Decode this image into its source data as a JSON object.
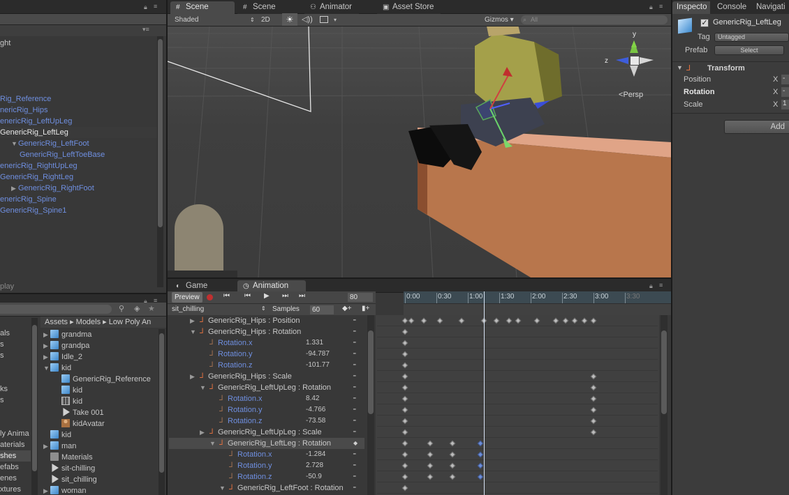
{
  "colors": {
    "accent_blue": "#6f8fe0",
    "record_red": "#c03030",
    "playhead": "#d8e4f5",
    "crate": "#c98a60"
  },
  "hierarchy": {
    "items": [
      {
        "label": "ght",
        "indent": 0,
        "arrow": "",
        "selected": false,
        "color": "grey"
      },
      {
        "label": "Rig_Reference",
        "indent": 0,
        "arrow": "",
        "selected": false,
        "color": "blue"
      },
      {
        "label": "nericRig_Hips",
        "indent": 0,
        "arrow": "",
        "selected": false,
        "color": "blue"
      },
      {
        "label": "enericRig_LeftUpLeg",
        "indent": 0,
        "arrow": "",
        "selected": false,
        "color": "blue"
      },
      {
        "label": "GenericRig_LeftLeg",
        "indent": 0,
        "arrow": "",
        "selected": true,
        "color": "white"
      },
      {
        "label": "GenericRig_LeftFoot",
        "indent": 1,
        "arrow": "▼",
        "selected": false,
        "color": "blue"
      },
      {
        "label": "GenericRig_LeftToeBase",
        "indent": 2,
        "arrow": "",
        "selected": false,
        "color": "blue"
      },
      {
        "label": "enericRig_RightUpLeg",
        "indent": 0,
        "arrow": "",
        "selected": false,
        "color": "blue"
      },
      {
        "label": "GenericRig_RightLeg",
        "indent": 0,
        "arrow": "",
        "selected": false,
        "color": "blue"
      },
      {
        "label": "GenericRig_RightFoot",
        "indent": 1,
        "arrow": "▶",
        "selected": false,
        "color": "blue"
      },
      {
        "label": "enericRig_Spine",
        "indent": 0,
        "arrow": "",
        "selected": false,
        "color": "blue"
      },
      {
        "label": "GenericRig_Spine1",
        "indent": 0,
        "arrow": "",
        "selected": false,
        "color": "blue"
      }
    ]
  },
  "scene_tabs": [
    {
      "label": "Scene",
      "icon": "scene-icon",
      "active": true
    },
    {
      "label": "Scene",
      "icon": "scene-icon",
      "active": false
    },
    {
      "label": "Animator",
      "icon": "animator-icon",
      "active": false
    },
    {
      "label": "Asset Store",
      "icon": "asset-store-icon",
      "active": false
    }
  ],
  "scene_toolbar": {
    "shading": "Shaded",
    "mode_2d": "2D",
    "gizmos": "Gizmos",
    "search_placeholder": "All"
  },
  "gizmo": {
    "y_label": "y",
    "z_label": "z",
    "persp_label": "Persp"
  },
  "inspector": {
    "tabs": [
      "Inspecto",
      "Console",
      "Navigati"
    ],
    "object_name": "GenericRig_LeftLeg",
    "tag_label": "Tag",
    "tag_value": "Untagged",
    "prefab_label": "Prefab",
    "prefab_button": "Select",
    "transform_title": "Transform",
    "position_label": "Position",
    "rotation_label": "Rotation",
    "scale_label": "Scale",
    "axis_x": "X",
    "position_value": "-",
    "rotation_value": "-",
    "scale_value": "1",
    "add_button": "Add"
  },
  "project": {
    "breadcrumb": [
      "Assets",
      "Models",
      "Low Poly An"
    ],
    "left_items": [
      "als",
      "s",
      "s",
      "ks",
      "s",
      "ly Anima",
      "aterials",
      "shes",
      "efabs",
      "enes",
      "xtures"
    ],
    "items": [
      {
        "label": "grandma",
        "indent": 0,
        "icon": "cube",
        "arrow": "▶"
      },
      {
        "label": "grandpa",
        "indent": 0,
        "icon": "cube",
        "arrow": "▶"
      },
      {
        "label": "Idle_2",
        "indent": 0,
        "icon": "cube",
        "arrow": "▶"
      },
      {
        "label": "kid",
        "indent": 0,
        "icon": "cube",
        "arrow": "▼"
      },
      {
        "label": "GenericRig_Reference",
        "indent": 1,
        "icon": "cube",
        "arrow": ""
      },
      {
        "label": "kid",
        "indent": 1,
        "icon": "cube",
        "arrow": ""
      },
      {
        "label": "kid",
        "indent": 1,
        "icon": "grid",
        "arrow": ""
      },
      {
        "label": "Take 001",
        "indent": 1,
        "icon": "clip",
        "arrow": ""
      },
      {
        "label": "kidAvatar",
        "indent": 1,
        "icon": "avatar",
        "arrow": ""
      },
      {
        "label": "kid",
        "indent": 0,
        "icon": "prefab",
        "arrow": ""
      },
      {
        "label": "man",
        "indent": 0,
        "icon": "cube",
        "arrow": "▶"
      },
      {
        "label": "Materials",
        "indent": 0,
        "icon": "folder",
        "arrow": ""
      },
      {
        "label": "sit-chilling",
        "indent": 0,
        "icon": "clip",
        "arrow": ""
      },
      {
        "label": "sit_chilling",
        "indent": 0,
        "icon": "clip",
        "arrow": ""
      },
      {
        "label": "woman",
        "indent": 0,
        "icon": "cube",
        "arrow": "▶"
      }
    ]
  },
  "bottom_tabs": [
    {
      "label": "Game",
      "icon": "game-icon",
      "active": false
    },
    {
      "label": "Animation",
      "icon": "animation-icon",
      "active": true
    }
  ],
  "animation": {
    "preview_label": "Preview",
    "frame": "80",
    "clip_name": "sit_chilling",
    "samples_label": "Samples",
    "samples_value": "60",
    "time_ticks": [
      "0:00",
      "0:30",
      "1:00",
      "1:30",
      "2:00",
      "2:30",
      "3:00",
      "3:30"
    ],
    "playhead_time": "1:15",
    "rows": [
      {
        "label": "GenericRig_Hips : Position",
        "value": "",
        "indent": 0,
        "arrow": "▶",
        "sub": false,
        "highlight": false,
        "keys": [
          0,
          0.1,
          0.3,
          0.55,
          0.9,
          1.25,
          1.45,
          1.65,
          1.8,
          2.1,
          2.4,
          2.55,
          2.7,
          2.85,
          3.0
        ]
      },
      {
        "label": "GenericRig_Hips : Rotation",
        "value": "",
        "indent": 0,
        "arrow": "▼",
        "sub": false,
        "highlight": false,
        "keys": [
          0
        ]
      },
      {
        "label": "Rotation.x",
        "value": "1.331",
        "indent": 1,
        "arrow": "",
        "sub": true,
        "highlight": false,
        "keys": [
          0
        ]
      },
      {
        "label": "Rotation.y",
        "value": "-94.787",
        "indent": 1,
        "arrow": "",
        "sub": true,
        "highlight": false,
        "keys": [
          0
        ]
      },
      {
        "label": "Rotation.z",
        "value": "-101.77",
        "indent": 1,
        "arrow": "",
        "sub": true,
        "highlight": false,
        "keys": [
          0
        ]
      },
      {
        "label": "GenericRig_Hips : Scale",
        "value": "",
        "indent": 0,
        "arrow": "▶",
        "sub": false,
        "highlight": false,
        "keys": [
          0,
          3.0
        ]
      },
      {
        "label": "GenericRig_LeftUpLeg : Rotation",
        "value": "",
        "indent": 1,
        "arrow": "▼",
        "sub": false,
        "highlight": false,
        "keys": [
          0,
          3.0
        ]
      },
      {
        "label": "Rotation.x",
        "value": "8.42",
        "indent": 2,
        "arrow": "",
        "sub": true,
        "highlight": false,
        "keys": [
          0,
          3.0
        ]
      },
      {
        "label": "Rotation.y",
        "value": "-4.766",
        "indent": 2,
        "arrow": "",
        "sub": true,
        "highlight": false,
        "keys": [
          0,
          3.0
        ]
      },
      {
        "label": "Rotation.z",
        "value": "-73.58",
        "indent": 2,
        "arrow": "",
        "sub": true,
        "highlight": false,
        "keys": [
          0,
          3.0
        ]
      },
      {
        "label": "GenericRig_LeftUpLeg : Scale",
        "value": "",
        "indent": 1,
        "arrow": "▶",
        "sub": false,
        "highlight": false,
        "keys": [
          0,
          3.0
        ]
      },
      {
        "label": "GenericRig_LeftLeg : Rotation",
        "value": "",
        "indent": 2,
        "arrow": "▼",
        "sub": false,
        "highlight": true,
        "keys": [
          0,
          0.4,
          0.75,
          1.2
        ]
      },
      {
        "label": "Rotation.x",
        "value": "-1.284",
        "indent": 3,
        "arrow": "",
        "sub": true,
        "highlight": false,
        "keys": [
          0,
          0.4,
          0.75,
          1.2
        ]
      },
      {
        "label": "Rotation.y",
        "value": "2.728",
        "indent": 3,
        "arrow": "",
        "sub": true,
        "highlight": false,
        "keys": [
          0,
          0.4,
          0.75,
          1.2
        ]
      },
      {
        "label": "Rotation.z",
        "value": "-50.9",
        "indent": 3,
        "arrow": "",
        "sub": true,
        "highlight": false,
        "keys": [
          0,
          0.4,
          0.75,
          1.2
        ]
      },
      {
        "label": "GenericRig_LeftFoot : Rotation",
        "value": "",
        "indent": 3,
        "arrow": "▼",
        "sub": false,
        "highlight": false,
        "keys": [
          0
        ]
      }
    ]
  }
}
